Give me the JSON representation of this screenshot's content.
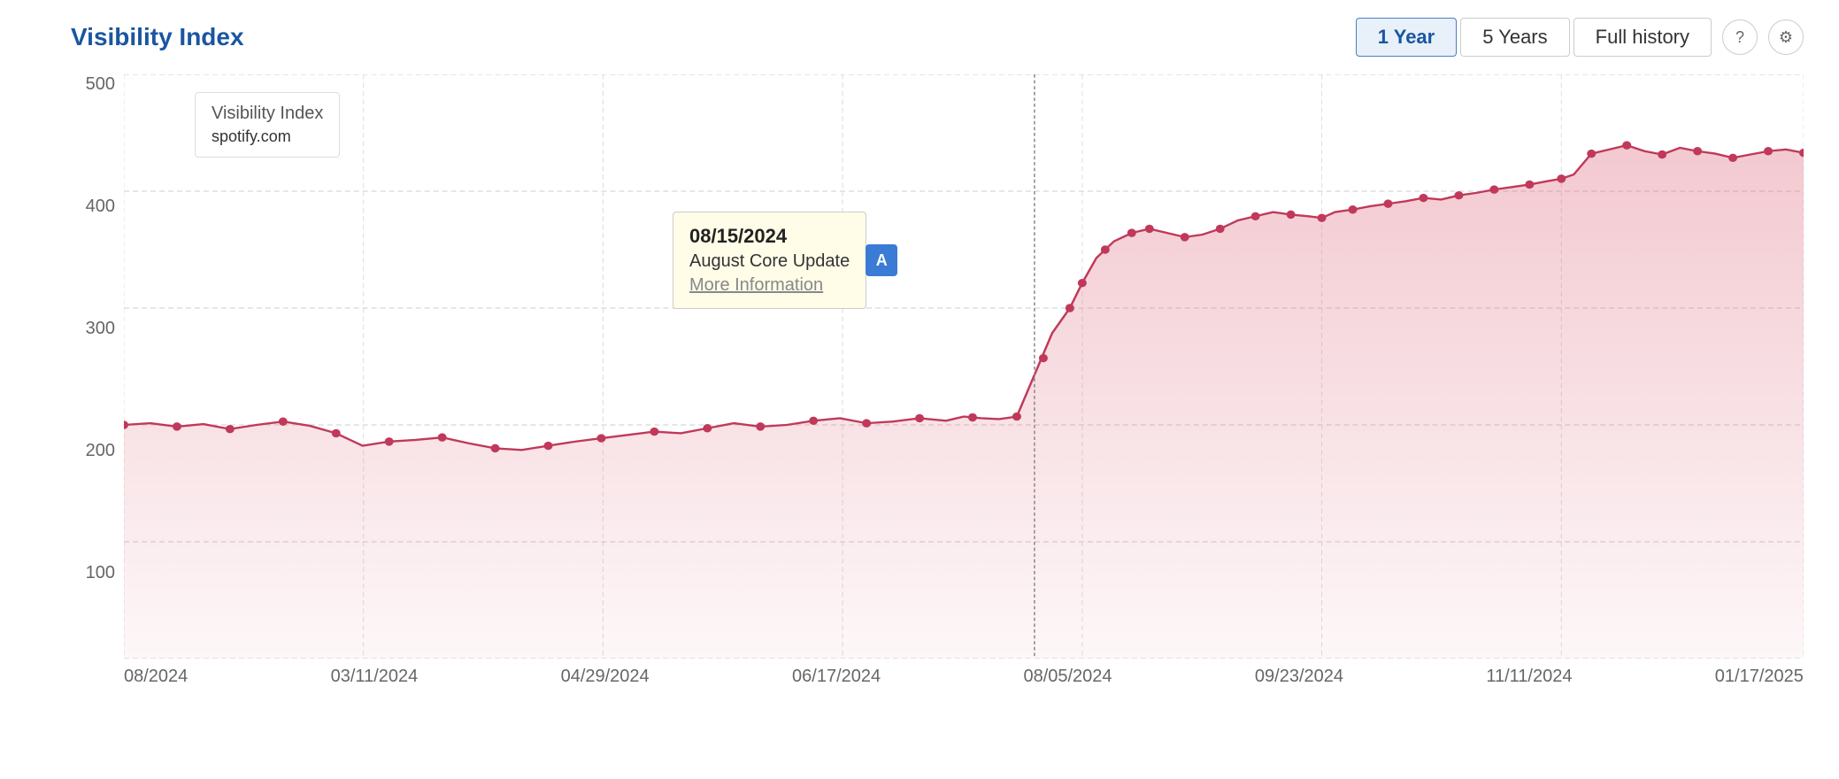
{
  "header": {
    "title": "Visibility Index",
    "buttons": {
      "one_year": "1 Year",
      "five_years": "5 Years",
      "full_history": "Full history"
    }
  },
  "legend": {
    "title": "Visibility Index",
    "domain": "spotify.com"
  },
  "tooltip": {
    "date": "08/15/2024",
    "event": "August Core Update",
    "link": "More Information",
    "badge": "A"
  },
  "y_axis": {
    "labels": [
      "500",
      "400",
      "300",
      "200",
      "100",
      ""
    ]
  },
  "x_axis": {
    "labels": [
      "08/2024",
      "03/11/2024",
      "04/29/2024",
      "06/17/2024",
      "08/05/2024",
      "09/23/2024",
      "11/11/2024",
      "01/17/2025"
    ]
  },
  "chart": {
    "line_color": "#c0395a",
    "fill_color": "rgba(220, 100, 120, 0.18)"
  }
}
